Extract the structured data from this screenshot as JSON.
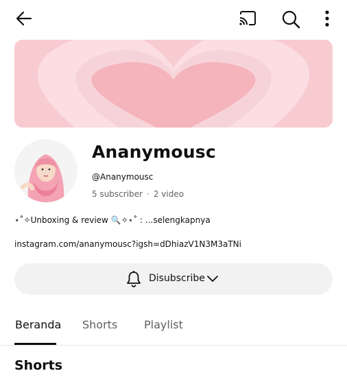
{
  "header": {
    "back_icon": "arrow-left-icon",
    "actions": [
      "cast-icon",
      "search-icon",
      "more-vertical-icon"
    ]
  },
  "banner": {
    "image": "pink-heart-banner"
  },
  "channel": {
    "name": "Ananymousc",
    "handle": "@Ananymousc",
    "subscribers": "5 subscriber",
    "separator": "·",
    "videos": "2 video",
    "description": "⋆˚✧Unboxing & review 🔍✧⋆˚ :",
    "more_label": "...selengkapnya",
    "link": "instagram.com/ananymousc?igsh=dDhiazV1N3M3aTNi"
  },
  "subscribe_button": {
    "label": "Disubscribe",
    "icon": "bell-icon",
    "dropdown_icon": "chevron-down-icon"
  },
  "tabs": [
    {
      "label": "Beranda",
      "active": true
    },
    {
      "label": "Shorts",
      "active": false
    },
    {
      "label": "Playlist",
      "active": false
    }
  ],
  "section": {
    "title": "Shorts"
  },
  "colors": {
    "banner_pink": "#f7c9cf",
    "heart_pink": "#f5b3bc",
    "text": "#0f0f0f",
    "muted": "#606060",
    "button_bg": "#f2f2f2"
  }
}
